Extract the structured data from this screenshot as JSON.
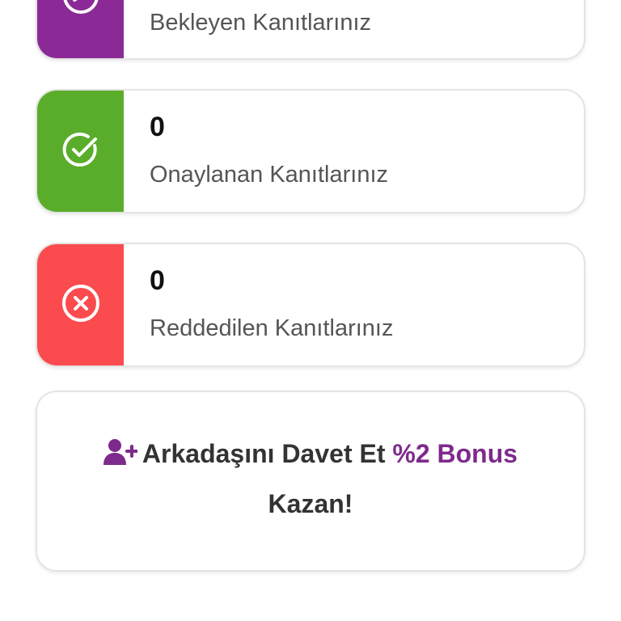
{
  "colors": {
    "pending": "#8b2a97",
    "approved": "#5aad2a",
    "rejected": "#fb4b4e",
    "accent": "#7e2a8c"
  },
  "cards": {
    "pending": {
      "label": "Bekleyen Kanıtlarınız",
      "icon": "clock-icon"
    },
    "approved": {
      "count": "0",
      "label": "Onaylanan Kanıtlarınız",
      "icon": "check-circle-icon"
    },
    "rejected": {
      "count": "0",
      "label": "Reddedilen Kanıtlarınız",
      "icon": "x-circle-icon"
    }
  },
  "invite": {
    "icon": "user-plus-icon",
    "text_before": "Arkadaşını Davet Et ",
    "accent_text": "%2 Bonus",
    "text_after": "Kazan!"
  }
}
